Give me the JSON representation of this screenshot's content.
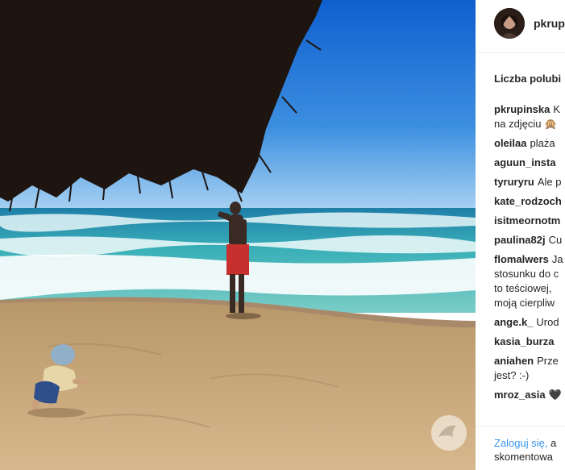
{
  "post": {
    "username": "pkrup",
    "likes_label": "Liczba polubi",
    "comments": [
      {
        "author": "pkrupinska",
        "text": "K",
        "line2": "na zdjęciu 🙊"
      },
      {
        "author": "oleilaa",
        "text": "plaża"
      },
      {
        "author": "aguun_insta",
        "text": ""
      },
      {
        "author": "tyruryru",
        "text": "Ale p"
      },
      {
        "author": "kate_rodzoch",
        "text": ""
      },
      {
        "author": "isitmeornotm",
        "text": ""
      },
      {
        "author": "paulina82j",
        "text": "Cu"
      },
      {
        "author": "flomalwers",
        "text": "Ja",
        "line2": "stosunku do c",
        "line3": "to teściowej,",
        "line4": "moją cierpliw"
      },
      {
        "author": "ange.k_",
        "text": "Urod"
      },
      {
        "author": "kasia_burza",
        "text": ""
      },
      {
        "author": "aniahen",
        "text": "Prze",
        "line2": "jest? :-)"
      },
      {
        "author": "mroz_asia",
        "text": "🖤"
      }
    ],
    "login": {
      "link_label": "Zaloguj się,",
      "rest_label": "a",
      "line2": "skomentowa"
    }
  },
  "colors": {
    "sky_top": "#1a6fd6",
    "sky_bottom": "#8ec3ee",
    "sea": "#2f9bb0",
    "sand": "#c7a67a",
    "swimsuit": "#c8302f",
    "link": "#3897f0"
  },
  "icons": {
    "watermark": "bird-logo-icon"
  }
}
